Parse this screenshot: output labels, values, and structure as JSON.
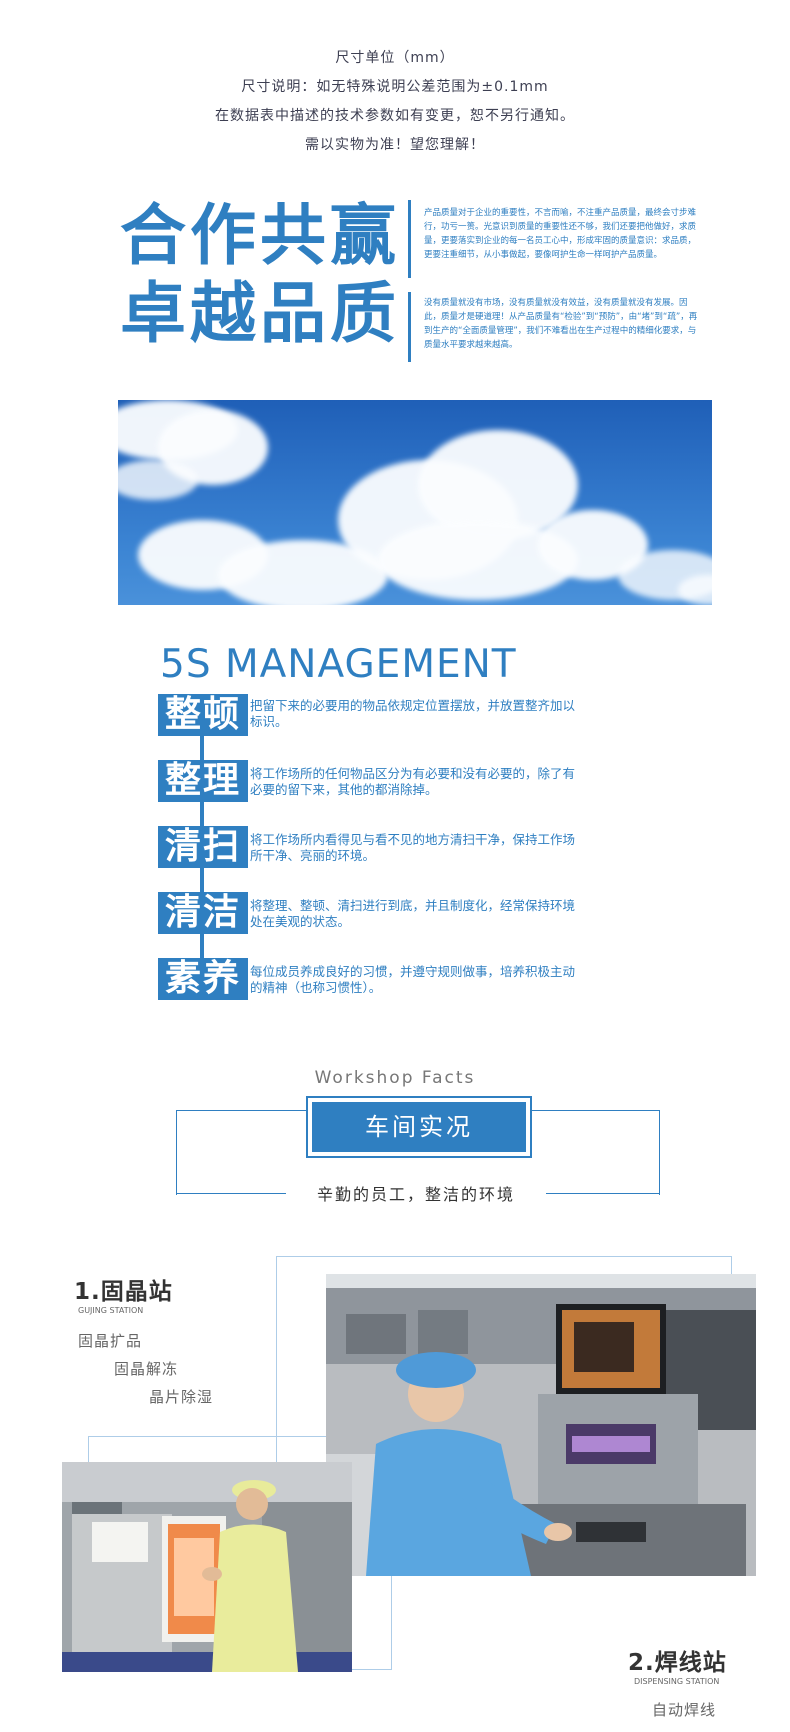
{
  "notice": {
    "line1": "尺寸单位（mm）",
    "line2": "尺寸说明：如无特殊说明公差范围为±0.1mm",
    "line3": "在数据表中描述的技术参数如有变更，恕不另行通知。",
    "line4": "需以实物为准！望您理解！"
  },
  "slogan": {
    "line1": "合作共赢",
    "line2": "卓越品质",
    "para1": "产品质量对于企业的重要性，不言而喻，不注重产品质量，最终会寸步难行，功亏一篑。光意识到质量的重要性还不够，我们还要把他做好，求质量，更要落实到企业的每一名员工心中，形成牢固的质量意识：求品质，更要注重细节，从小事做起，要像呵护生命一样呵护产品质量。",
    "para2": "没有质量就没有市场，没有质量就没有效益，没有质量就没有发展。因此，质量才是硬道理！从产品质量有“检验”到“预防”，由“堵”到“疏”，再到生产的“全面质量管理”，我们不难看出在生产过程中的精细化要求，与质量水平要求越来越高。"
  },
  "five_s": {
    "title": "5S MANAGEMENT",
    "items": [
      {
        "label": "整顿",
        "desc": "把留下来的必要用的物品依规定位置摆放，并放置整齐加以标识。"
      },
      {
        "label": "整理",
        "desc": "将工作场所的任何物品区分为有必要和没有必要的，除了有必要的留下来，其他的都消除掉。"
      },
      {
        "label": "清扫",
        "desc": "将工作场所内看得见与看不见的地方清扫干净，保持工作场所干净、亮丽的环境。"
      },
      {
        "label": "清洁",
        "desc": "将整理、整顿、清扫进行到底，并且制度化，经常保持环境处在美观的状态。"
      },
      {
        "label": "素养",
        "desc": "每位成员养成良好的习惯，并遵守规则做事，培养积极主动的精神（也称习惯性）。"
      }
    ]
  },
  "workshop": {
    "eyebrow": "Workshop Facts",
    "title": "车间实况",
    "subtitle": "辛勤的员工，整洁的环境"
  },
  "stations": {
    "s1": {
      "title": "1.固晶站",
      "sub": "GUJING STATION",
      "items": [
        "固晶扩品",
        "固晶解冻",
        "晶片除湿"
      ]
    },
    "s2": {
      "title": "2.焊线站",
      "sub": "DISPENSING STATION",
      "items": [
        "自动焊线"
      ]
    }
  },
  "colors": {
    "accent": "#2f7fc1"
  }
}
